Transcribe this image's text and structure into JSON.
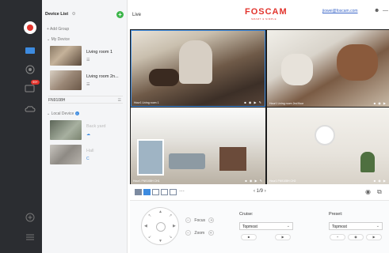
{
  "sidebar": {
    "badge_count": "99+",
    "icons": [
      "logo-icon",
      "monitor-icon",
      "playback-icon",
      "message-icon",
      "cloud-icon",
      "add-circle-icon",
      "menu-icon"
    ]
  },
  "device_list": {
    "title": "Device List",
    "add_group": "+ Add Group",
    "my_device": "My Device",
    "devices": [
      {
        "name": "Living room 1",
        "sub": "☰"
      },
      {
        "name": "Living room 2n...",
        "sub": "☰"
      }
    ],
    "fn_device": "FN9108H",
    "local_device": "Local Device",
    "local_devices": [
      {
        "name": "Back yard",
        "sub": "☁"
      },
      {
        "name": "Hall",
        "sub": "C"
      }
    ]
  },
  "topbar": {
    "tab": "Live",
    "brand": "FOSCAM",
    "brand_sub": "SMART & SIMPLE",
    "user_email": "jiowei@foscam.com"
  },
  "cameras": [
    {
      "caption": "Hour1 Living room 1"
    },
    {
      "caption": "Hour1 Living room 2nd floor"
    },
    {
      "caption": "Hour1 FN9108H CH1"
    },
    {
      "caption": "Hour1 FN9108H CH2"
    }
  ],
  "layout_bar": {
    "pager": "1/9"
  },
  "ptz": {
    "focus": "Focus",
    "zoom": "Zoom",
    "cruise_label": "Cruise:",
    "cruise_value": "Topmost",
    "preset_label": "Preset:",
    "preset_value": "Topmost"
  }
}
